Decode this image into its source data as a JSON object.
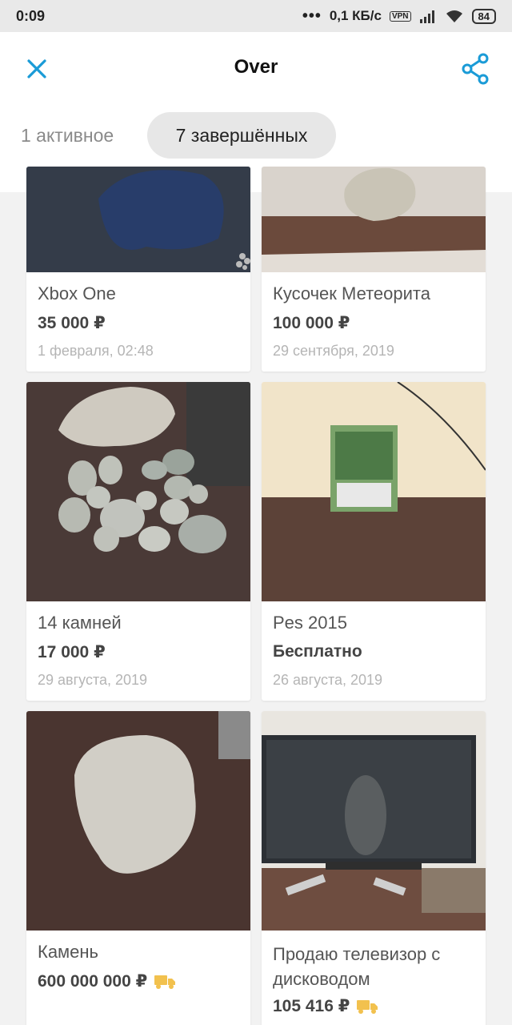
{
  "status": {
    "time": "0:09",
    "speed": "0,1 КБ/с",
    "vpn": "VPN",
    "battery": "84"
  },
  "header": {
    "title": "Over"
  },
  "tabs": [
    {
      "label": "1 активное"
    },
    {
      "label": "7 завершённых"
    }
  ],
  "listings": [
    {
      "title": "Xbox One",
      "price": "35 000 ₽",
      "date": "1 февраля, 02:48"
    },
    {
      "title": "Кусочек Метеорита",
      "price": "100 000 ₽",
      "date": "29 сентября, 2019"
    },
    {
      "title": "14 камней",
      "price": "17 000 ₽",
      "date": "29 августа, 2019"
    },
    {
      "title": "Pes 2015",
      "price": "Бесплатно",
      "date": "26 августа, 2019"
    },
    {
      "title": "Камень",
      "price": "600 000 000 ₽",
      "delivery": true
    },
    {
      "title": "Продаю телевизор с дисководом",
      "price": "105 416 ₽",
      "delivery": true
    }
  ],
  "colors": {
    "accent": "#1a9bd7",
    "delivery": "#f2c14e"
  },
  "icons": {
    "close": "close-icon",
    "share": "share-icon",
    "delivery": "truck-icon"
  }
}
